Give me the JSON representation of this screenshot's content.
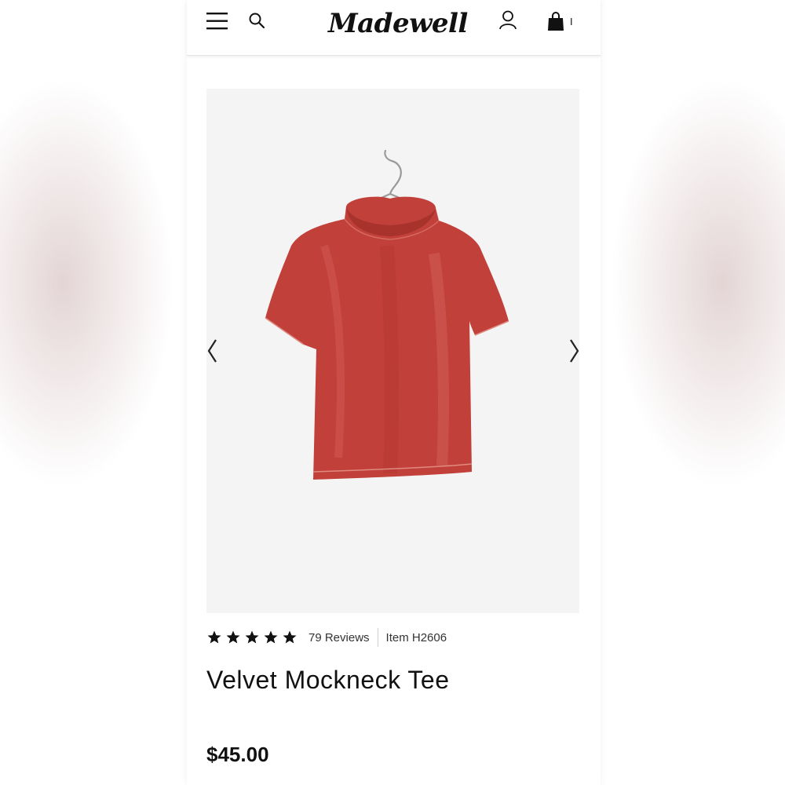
{
  "header": {
    "logo_text": "Madewell",
    "bag_count": "I",
    "icons": [
      "menu-icon",
      "search-icon",
      "account-icon",
      "shopping-bag-icon"
    ]
  },
  "gallery": {
    "background": "#f4f4f4",
    "garment_color": "#c2403a"
  },
  "product": {
    "rating": 5,
    "rating_max": 5,
    "reviews_label": "79 Reviews",
    "item_label": "Item H2606",
    "title": "Velvet Mockneck Tee",
    "price": "$45.00"
  }
}
